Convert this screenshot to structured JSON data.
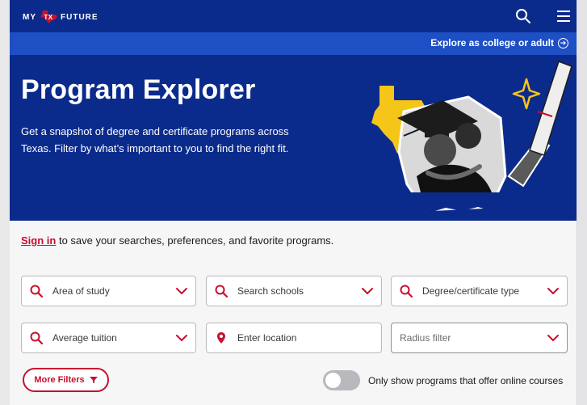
{
  "nav": {
    "logo_left": "MY",
    "logo_badge": "TX",
    "logo_right": "FUTURE"
  },
  "explore": {
    "link_label": "Explore as college or adult"
  },
  "hero": {
    "title": "Program Explorer",
    "description": "Get a snapshot of degree and certificate programs across Texas. Filter by what’s important to you to find the right fit."
  },
  "signin": {
    "link": "Sign in",
    "rest": " to save your searches, preferences, and favorite programs."
  },
  "filters": {
    "area_of_study": "Area of study",
    "search_schools": "Search schools",
    "degree_type": "Degree/certificate type",
    "average_tuition": "Average tuition",
    "location_placeholder": "Enter location",
    "radius": "Radius filter"
  },
  "more_filters": {
    "label": "More Filters"
  },
  "online_toggle": {
    "label": "Only show programs that offer online courses",
    "on": false
  },
  "colors": {
    "navy": "#0b2b8c",
    "blue": "#1e4fc4",
    "red": "#c8102e",
    "gold": "#f5c518"
  }
}
